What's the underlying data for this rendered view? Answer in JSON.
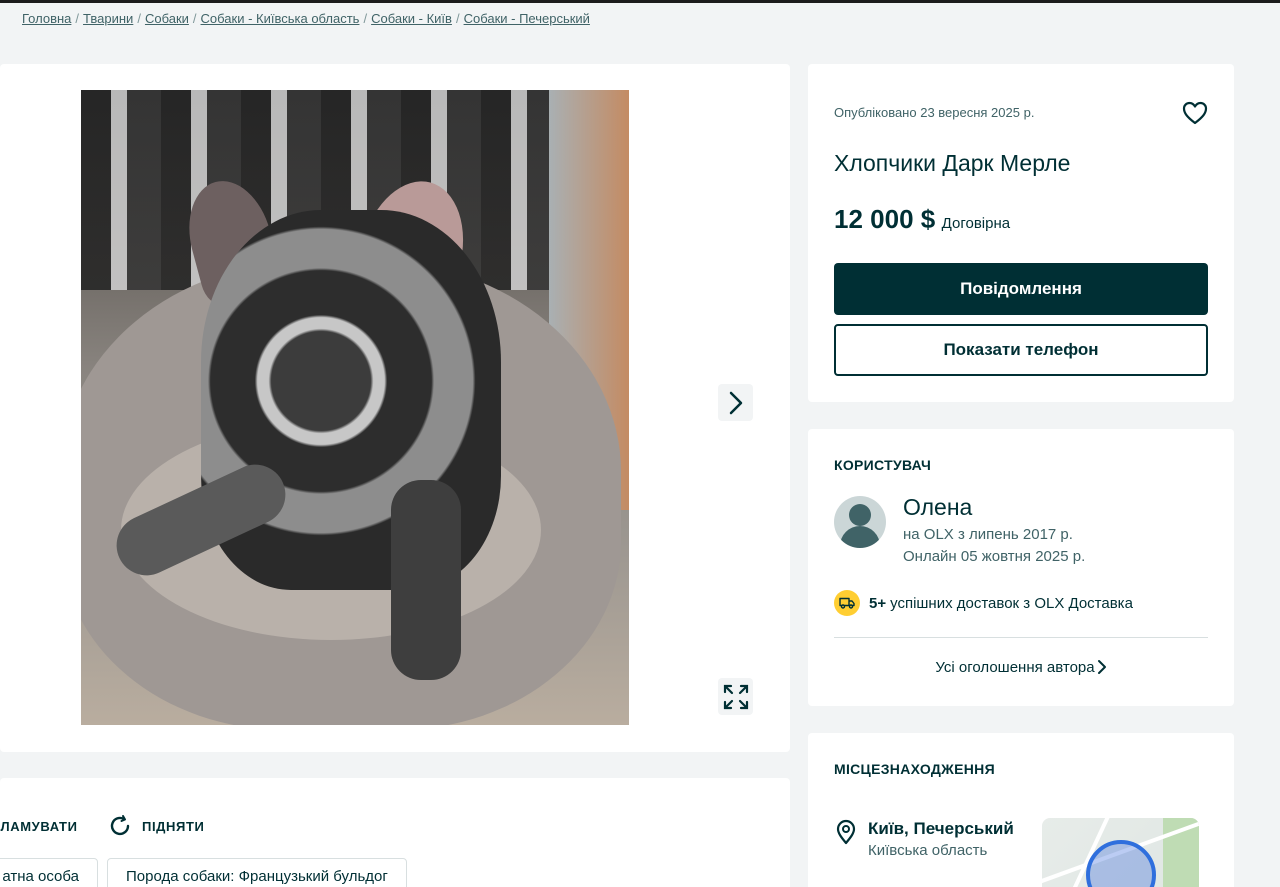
{
  "breadcrumb": [
    {
      "label": "Головна"
    },
    {
      "label": "Тварини"
    },
    {
      "label": "Собаки"
    },
    {
      "label": "Собаки - Київська область"
    },
    {
      "label": "Собаки - Київ"
    },
    {
      "label": "Собаки - Печерський"
    }
  ],
  "breadcrumb_separator": "/",
  "listing": {
    "published": "Опубліковано 23 вересня 2025 р.",
    "title": "Хлопчики Дарк Мерле",
    "price": "12 000 $",
    "negotiable": "Договірна",
    "message_button": "Повідомлення",
    "phone_button": "Показати телефон"
  },
  "seller": {
    "heading": "КОРИСТУВАЧ",
    "name": "Олена",
    "since": "на OLX з липень 2017 р.",
    "online": "Онлайн 05 жовтня 2025 р.",
    "delivery_count": "5+",
    "delivery_text": "успішних доставок з OLX Доставка",
    "all_ads": "Усі оголошення автора"
  },
  "location": {
    "heading": "МІСЦЕЗНАХОДЖЕННЯ",
    "city": "Київ, Печерський",
    "region": "Київська область"
  },
  "actions": {
    "promote": "КЛАМУВАТИ",
    "raise": "ПІДНЯТИ"
  },
  "tags": [
    {
      "label": "атна особа"
    },
    {
      "label": "Порода собаки: Французький бульдог"
    }
  ],
  "colors": {
    "primary": "#002f34",
    "background": "#f2f4f5",
    "delivery_badge": "#ffce32"
  },
  "icons": {
    "favorite": "heart-icon",
    "next": "chevron-right-icon",
    "fullscreen": "expand-icon",
    "delivery": "truck-icon",
    "location": "location-pin-icon",
    "raise": "refresh-icon"
  }
}
